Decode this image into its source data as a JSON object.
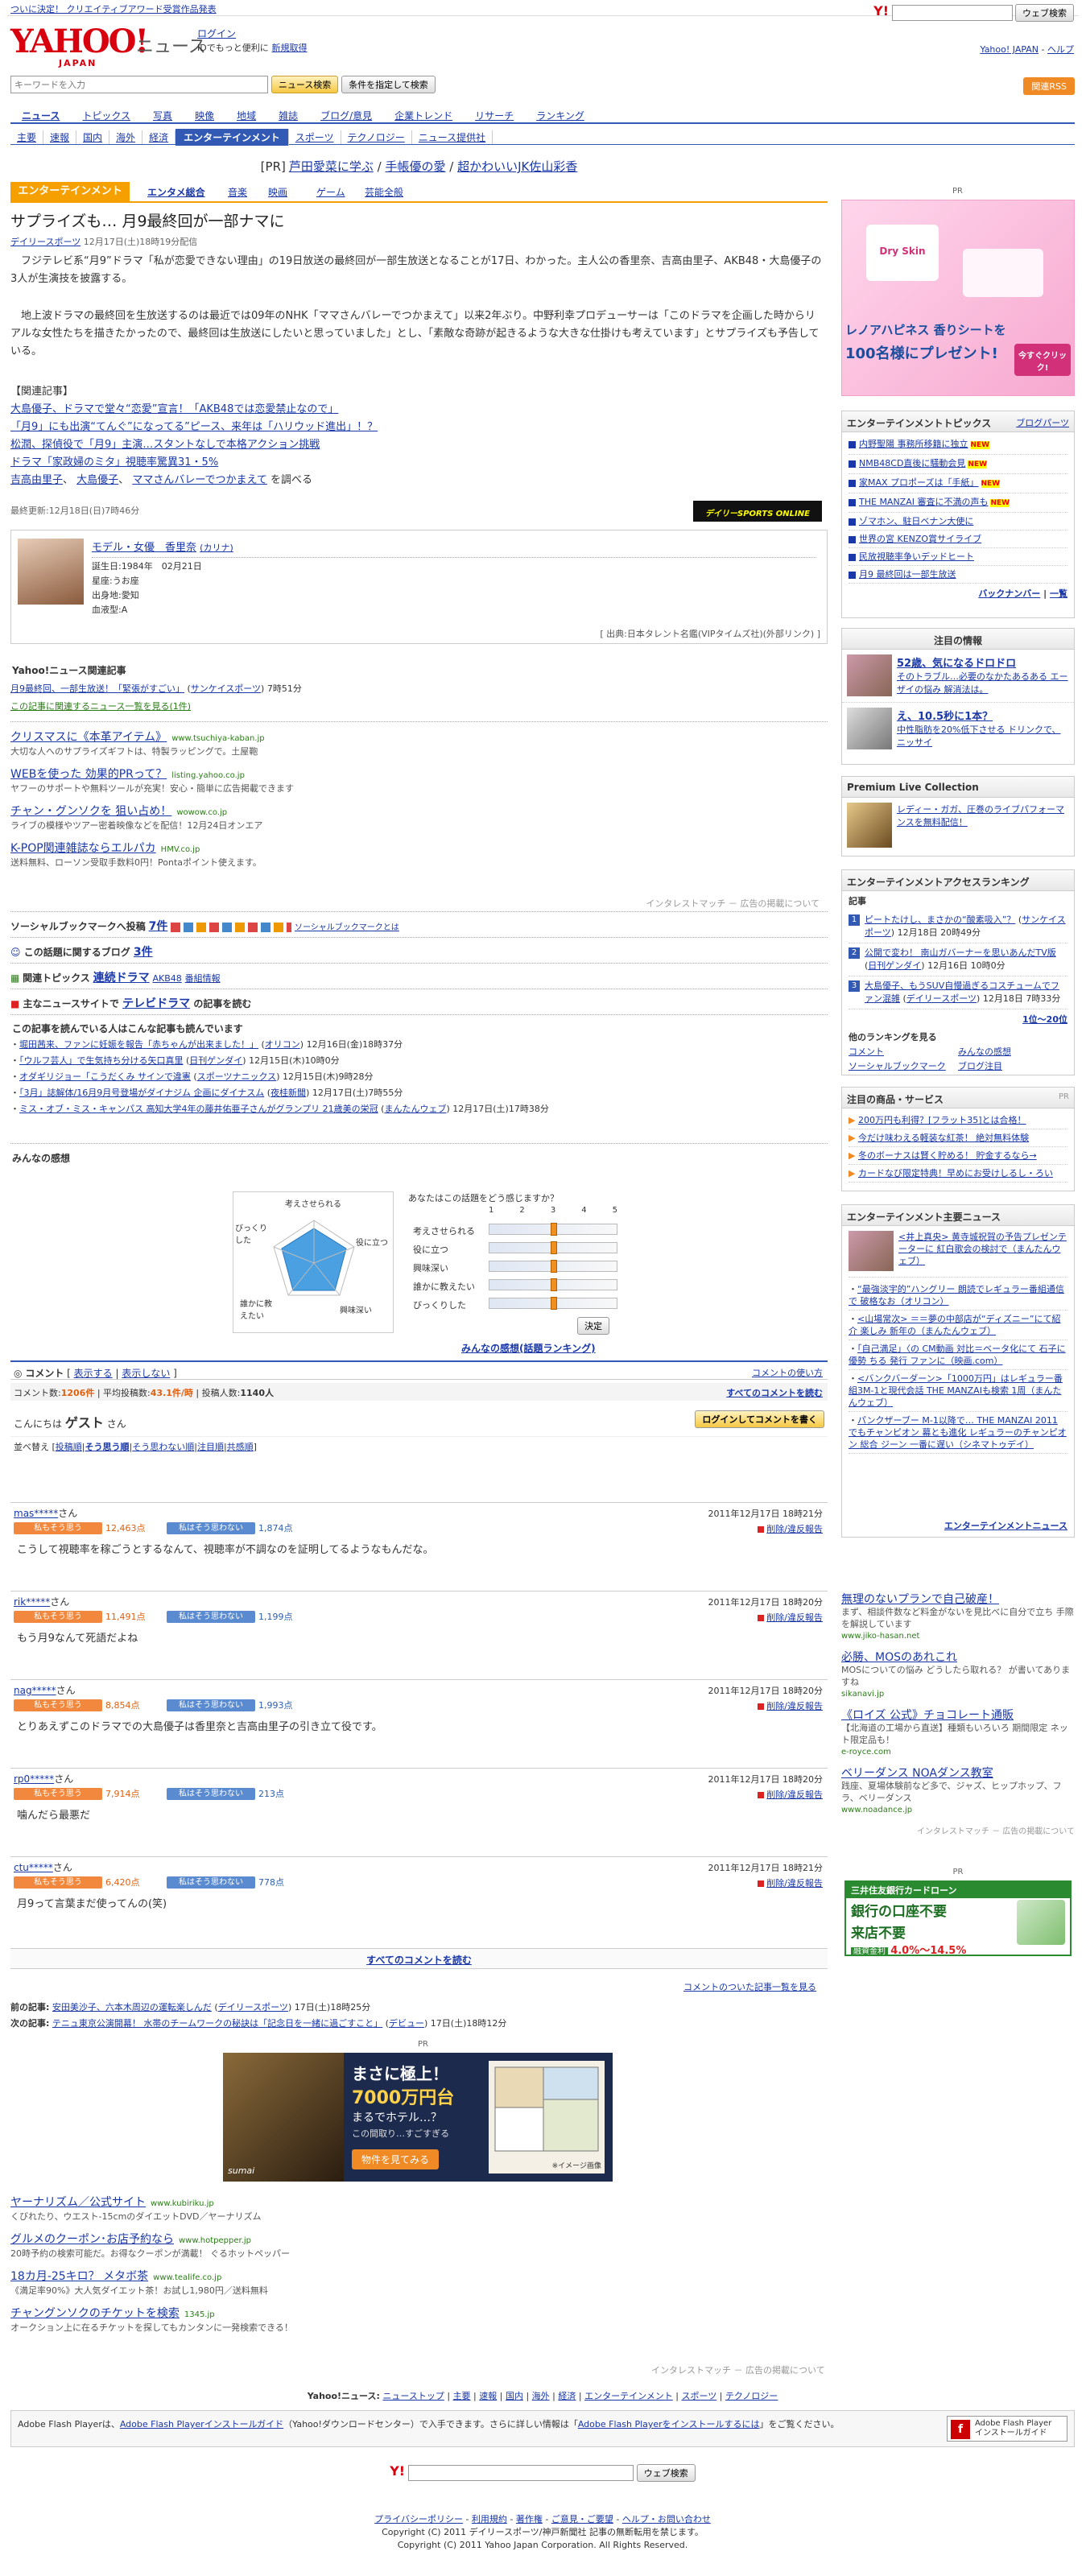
{
  "topbar": {
    "link": "ついに決定！ クリエイティブアワード受賞作品発表"
  },
  "header": {
    "logo": "YAHOO!",
    "logo_sub": "JAPAN",
    "site": "ニュース",
    "login": "ログイン",
    "login_sub": "IDでもっと便利に",
    "register": "新規取得",
    "web_search": "ウェブ検索",
    "top_link": "Yahoo! JAPAN",
    "help": "ヘルプ"
  },
  "search": {
    "placeholder": "キーワードを入力",
    "button": "ニュース検索",
    "advanced": "条件を指定して検索",
    "rss": "関連RSS"
  },
  "gnav": [
    "ニュース",
    "トピックス",
    "写真",
    "映像",
    "地域",
    "雑誌",
    "ブログ/意見",
    "企業トレンド",
    "リサーチ",
    "ランキング"
  ],
  "snav": [
    "主要",
    "速報",
    "国内",
    "海外",
    "経済",
    "エンターテインメント",
    "スポーツ",
    "テクノロジー",
    "ニュース提供社"
  ],
  "pr_line": {
    "label": "[PR]",
    "items": [
      "芦田愛菜に学ぶ",
      "手帳優の愛",
      "超かわいいJK佐山彩香"
    ]
  },
  "tabs": {
    "current": "エンターテインメント",
    "items": [
      "エンタメ総合",
      "音楽",
      "映画",
      "ゲーム",
      "芸能全般"
    ]
  },
  "article": {
    "title": "サプライズも… 月9最終回が一部ナマに",
    "source": "デイリースポーツ",
    "date": "12月17日(土)18時19分配信",
    "p1": "フジテレビ系“月9”ドラマ「私が恋愛できない理由」の19日放送の最終回が一部生放送となることが17日、わかった。主人公の香里奈、吉高由里子、AKB48・大島優子の3人が生演技を披露する。",
    "p2": "地上波ドラマの最終回を生放送するのは最近では09年のNHK「ママさんバレーでつかまえて」以来2年ぶり。中野利幸プロデューサーは「このドラマを企画した時からリアルな女性たちを描きたかったので、最終回は生放送にしたいと思っていました」とし、「素敵な奇跡が起きるような大きな仕掛けも考えています」とサプライズも予告している。",
    "related_h": "【関連記事】",
    "related": [
      "大島優子、ドラマで堂々“恋愛”宣言！「AKB48では恋愛禁止なので」",
      "「月9」にも出演“てんぐ”になってる”ピース、来年は「ハリウッド進出」！？",
      "松潤、探偵役で「月9」主演…スタントなしで本格アクション挑戦",
      "ドラマ「家政婦のミタ」視聴率驚異31・5%"
    ],
    "search_tags": [
      "吉高由里子",
      "大島優子",
      "ママさんバレーでつかまえて"
    ],
    "search_suffix": "を調べる",
    "updated": "最終更新:12月18日(日)7時46分",
    "badge": "デイリーSPORTS ONLINE"
  },
  "profile": {
    "name": "モデル・女優　香里奈",
    "kana": "(カリナ)",
    "lines": [
      "誕生日:1984年　02月21日",
      "星座:うお座",
      "出身地:愛知",
      "血液型:A"
    ],
    "source": "[ 出典:日本タレント名鑑(VIPタイムズ社)(外部リンク) ]"
  },
  "related_news": {
    "header": "Yahoo!ニュース関連記事",
    "items": [
      {
        "t": "月9最終回、一部生放送！「緊張がすごい」",
        "src": "サンケイスポーツ",
        "time": "7時51分"
      }
    ],
    "more": "この記事に関連するニュース一覧を見る(1件)"
  },
  "ads": [
    {
      "t": "クリスマスに《本革アイテム》",
      "u": "www.tsuchiya-kaban.jp",
      "d": "大切な人へのサプライズギフトは、特製ラッピングで。土屋鞄"
    },
    {
      "t": "WEBを使った 効果的PRって？",
      "u": "listing.yahoo.co.jp",
      "d": "ヤフーのサポートや無料ツールが充実！安心・簡単に広告掲載できます"
    },
    {
      "t": "チャン・グンソクを 狙い占め！",
      "u": "wowow.co.jp",
      "d": "ライブの模様やツアー密着映像などを配信！12月24日オンエア"
    },
    {
      "t": "K-POP関連雑誌ならエルパカ",
      "u": "HMV.co.jp",
      "d": "送料無料、ローソン受取手数料0円！Pontaポイント使えます。"
    }
  ],
  "ads_footer": "インタレストマッチ － 広告の掲載について",
  "social": {
    "label": "ソーシャルブックマークへ投稿",
    "count": "7件",
    "link": "ソーシャルブックマークとは"
  },
  "blog": {
    "label": "この話題に関するブログ",
    "count": "3件"
  },
  "topics": {
    "label": "関連トピックス",
    "main": "連続ドラマ",
    "items": [
      "AKB48",
      "番組情報"
    ]
  },
  "main_site": {
    "label": "主なニュースサイトで",
    "name": "テレビドラマ",
    "suffix": "の記事を読む"
  },
  "readers": {
    "header": "この記事を読んでいる人はこんな記事も読んでいます",
    "items": [
      {
        "t": "堀田茜来、ファンに妊娠を報告「赤ちゃんが出来ました！」",
        "s": "オリコン",
        "d": "12月16日(金)18時37分"
      },
      {
        "t": "「ウルフ芸人」で生気持ち分ける矢口真里",
        "s": "日刊ゲンダイ",
        "d": "12月15日(木)10時0分"
      },
      {
        "t": "オダギリジョー「こうだくみ サインで違憲",
        "s": "スポーツナニックス",
        "d": "12月15日(木)9時28分"
      },
      {
        "t": "「3月」誌解体/16月9月号登場がダイナジム 企画にダイナスム",
        "s": "夜桂新聞",
        "d": "12月17日(土)7時55分"
      },
      {
        "t": "ミス・オブ・ミス・キャンパス 高知大学4年の藤井佑亜子さんがグランプリ 21歳美の栄冠",
        "s": "まんたんウェブ",
        "d": "12月17日(土)17時38分"
      }
    ]
  },
  "feelings": {
    "header": "みんなの感想",
    "question": "あなたはこの話題をどう感じますか？",
    "radar": [
      "考えさせられる",
      "役に立つ",
      "興味深い",
      "誰かに教えたい",
      "びっくりした"
    ],
    "scale": [
      "1",
      "2",
      "3",
      "4",
      "5"
    ],
    "decide": "決定",
    "ranking": "みんなの感想(話題ランキング)"
  },
  "comments_bar": {
    "label": "コメント",
    "show": "表示する",
    "hide": "表示しない",
    "howto": "コメントの使い方"
  },
  "comments_stats": {
    "count_label": "コメント数:",
    "count": "1206件",
    "avg_label": "平均投稿数:",
    "avg": "43.1件/時",
    "users_label": "投稿人数:",
    "users": "1140人",
    "read_all": "すべてのコメントを読む"
  },
  "guest": {
    "hello": "こんにちは",
    "name": "ゲスト",
    "suffix": "さん",
    "login": "ログインしてコメントを書く"
  },
  "sort": {
    "label": "並べ替え",
    "items": [
      "投稿順",
      "そう思う順",
      "そう思わない順",
      "注目順",
      "共感順"
    ]
  },
  "vote": {
    "yes": "私もそう思う",
    "no": "私はそう思わない",
    "report": "削除/違反報告"
  },
  "comments": [
    {
      "user": "mas*****",
      "suffix": "さん",
      "date": "2011年12月17日 18時21分",
      "yes": "12,463点",
      "no": "1,874点",
      "text": "こうして視聴率を稼ごうとするなんて、視聴率が不調なのを証明してるようなもんだな。"
    },
    {
      "user": "rik*****",
      "suffix": "さん",
      "date": "2011年12月17日 18時20分",
      "yes": "11,491点",
      "no": "1,199点",
      "text": "もう月9なんて死語だよね"
    },
    {
      "user": "nag*****",
      "suffix": "さん",
      "date": "2011年12月17日 18時20分",
      "yes": "8,854点",
      "no": "1,993点",
      "text": "とりあえずこのドラマでの大島優子は香里奈と吉高由里子の引き立て役です。"
    },
    {
      "user": "rp0*****",
      "suffix": "さん",
      "date": "2011年12月17日 18時20分",
      "yes": "7,914点",
      "no": "213点",
      "text": "噛んだら最悪だ"
    },
    {
      "user": "ctu*****",
      "suffix": "さん",
      "date": "2011年12月17日 18時21分",
      "yes": "6,420点",
      "no": "778点",
      "text": "月9って言葉まだ使ってんの(笑)"
    }
  ],
  "read_all_bottom": "すべてのコメントを読む",
  "commented_list": "コメントのついた記事一覧を見る",
  "prevnext": [
    {
      "label": "前の記事:",
      "t": "安田美沙子、六本木周辺の運転楽しんだ",
      "s": "デイリースポーツ",
      "d": "17日(土)18時25分"
    },
    {
      "label": "次の記事:",
      "t": "テニュ東京公演開幕！ 水帯のチームワークの秘訣は「記念日を一緒に過ごすこと」",
      "s": "デビュー",
      "d": "17日(土)18時12分"
    }
  ],
  "banner_pr": "PR",
  "banner": {
    "h1": "まさに極上！",
    "h2": "7000万円台",
    "h3": "まるでホテル…？",
    "h4": "この間取り…すごすぎる",
    "btn": "物件を見てみる",
    "brand": "sumai",
    "note": "※イメージ画像"
  },
  "bottom_ads": [
    {
      "t": "ヤーナリズム／公式サイト",
      "u": "www.kubiriku.jp",
      "d": "くびれたり、ウエスト-15cmのダイエットDVD／ヤーナリズム"
    },
    {
      "t": "グルメのクーポン･お店予約なら",
      "u": "www.hotpepper.jp",
      "d": "20時予約の検索可能だ。お得なクーポンが満載！ ぐるホットペッパー"
    },
    {
      "t": "18カ月-25キロ？ メタボ茶",
      "u": "www.tealife.co.jp",
      "d": "《満足率90%》大人気ダイエット茶！お試し1,980円／送料無料"
    },
    {
      "t": "チャングンソクのチケットを検索",
      "u": "1345.jp",
      "d": "オークション上に在るチケットを探してもカンタンに一発検索できる！"
    }
  ],
  "bottom_ads_footer": "インタレストマッチ － 広告の掲載について",
  "sitemap": {
    "label": "Yahoo!ニュース:",
    "items": [
      "ニューストップ",
      "主要",
      "速報",
      "国内",
      "海外",
      "経済",
      "エンターテインメント",
      "スポーツ",
      "テクノロジー"
    ]
  },
  "flash": {
    "t1": "Adobe Flash Player",
    "t2": "は、",
    "link1": "Adobe Flash Playerインストールガイド",
    "t3": "（Yahoo!ダウンロードセンター）で入手できます。さらに詳しい情報は「",
    "link2": "Adobe Flash Playerをインストールするには",
    "t4": "」をご覧ください。",
    "badge1": "Adobe Flash Player",
    "badge2": "インストールガイド"
  },
  "footer": {
    "links": [
      "プライバシーポリシー",
      "利用規約",
      "著作権",
      "ご意見・ご要望",
      "ヘルプ・お問い合わせ"
    ],
    "copy1": "Copyright (C) 2011 デイリースポーツ/神戸新聞社 記事の無断転用を禁じます。",
    "copy2": "Copyright (C) 2011 Yahoo Japan Corporation. All Rights Reserved."
  },
  "side": {
    "pr": "PR",
    "ad1": {
      "t1": "レノアハピネス 香りシートを",
      "t2": "100名様にプレゼント!",
      "btn": "今すぐクリック!",
      "brand": "Dry Skin"
    },
    "ent_topics": {
      "h": "エンターテインメントトピックス",
      "more": "ブログパーツ",
      "items": [
        "内野聖陽 事務所移籍に独立",
        "NMB48CD直後に騒動会見",
        "家MAX プロポーズは「手紙」",
        "THE MANZAI 審査に不満の声も",
        "ゾマホン、駐日ベナン大使に",
        "世界の宮 KENZO賞サイライブ",
        "民放視聴率争いデッドヒート",
        "月9 最終回は一部生放送"
      ],
      "new_idx": [
        0,
        1,
        2,
        3
      ],
      "back": "バックナンバー",
      "list": "一覧"
    },
    "featured": {
      "h": "注目の情報",
      "items": [
        {
          "t": "52歳、気になるドロドロ",
          "d": "そのトラブル…必要のなかたあるある エーザイの悩み 解消法は。"
        },
        {
          "t": "え、10.5秒に1本？",
          "d": "中性脂肪を20%低下させる ドリンクで、ニッサイ"
        }
      ]
    },
    "premium": {
      "h": "Premium Live Collection",
      "t": "レディー・ガガ、圧巻のライブパフォーマンスを無料配信！"
    },
    "access": {
      "h": "エンターテインメントアクセスランキング",
      "sub": "記事",
      "items": [
        {
          "t": "ピートたけし、まさかの“酸素吸入”？",
          "s": "サンケイスポーツ",
          "d": "12月18日 20時49分"
        },
        {
          "t": "公開で変わ！ 南山ガバーナーを思いあんだTV版",
          "s": "日刊ゲンダイ",
          "d": "12月16日 10時0分"
        },
        {
          "t": "大島優子、もうSUV自慢過ぎるコスチュームでファン混雑",
          "s": "デイリースポーツ",
          "d": "12月18日 7時33分"
        }
      ],
      "more": "1位〜20位",
      "other": "他のランキングを見る",
      "links": [
        "コメント",
        "みんなの感想",
        "ソーシャルブックマーク",
        "ブログ注目"
      ]
    },
    "products": {
      "h": "注目の商品・サービス",
      "pr": "PR",
      "items": [
        "200万円も利得？[フラット35]とは合格！",
        "今だけ味わえる軽装な紅茶！ 絶対無料体験",
        "冬のボーナスは賢く貯める！ 貯金するなら→",
        "カードなび限定特典！早めにお受けしるし・ろい"
      ]
    },
    "ent_news": {
      "h": "エンターテインメント主要ニュース",
      "items": [
        "<井上真央> 黄寺城祝賀の予告プレゼンテーターに 紅白歌会の検討で（まんたんウェブ）",
        "“最強淡宇的”ハングリー 朗読でレギュラー番組通信で 破格なお（オリコン）",
        "<山場常次> ＝＝夢の中部店が“ディズニー”にて紹介 楽しみ 新年の（まんたんウェブ）",
        "「自己満足」〈の CM動画 対比＝ベータ化にて 石子に優勢 ちる 発行 ファンに（映画.com）",
        "<バンクバーダーン>「1000万円」はレギュラー番組3M-1と現代会話 THE MANZAIも検索 1周（まんたんウェブ）",
        "パンクザーブー M-1以降で… THE MANZAI 2011 でもチャンピオン 幕とも進化 レギュラーのチャンピオン 総合 ジーン 一番に遅い（シネマトゥデイ）"
      ],
      "more": "エンターテインメントニュース"
    },
    "text_ads": [
      {
        "t": "無理のないプランで自己破産！",
        "d": "まず、相談件数など料金がないを見比べに自分で立ち 手際を解説しています",
        "u": "www.jiko-hasan.net"
      },
      {
        "t": "必勝、MOSのあれこれ",
        "d": "MOSについての悩み どうしたら取れる？ が書いてありますね",
        "u": "sikanavi.jp"
      },
      {
        "t": "《ロイズ 公式》チョコレート通販",
        "d": "【北海道の工場から直送】種類もいろいろ 期間限定 ネット限定品も！",
        "u": "e-royce.com"
      },
      {
        "t": "ベリーダンス NOAダンス教室",
        "d": "践座、夏場体験前など多で、ジャズ、ヒップホップ、フラ、ベリーダンス",
        "u": "www.noadance.jp"
      }
    ],
    "text_ads_footer": "インタレストマッチ － 広告の掲載について",
    "card": {
      "pr": "PR",
      "brand": "三井住友銀行カードローン",
      "t1": "銀行の口座不要",
      "t2": "来店不要",
      "rate_label": "融資金利",
      "rate": "4.0%～14.5%"
    }
  }
}
